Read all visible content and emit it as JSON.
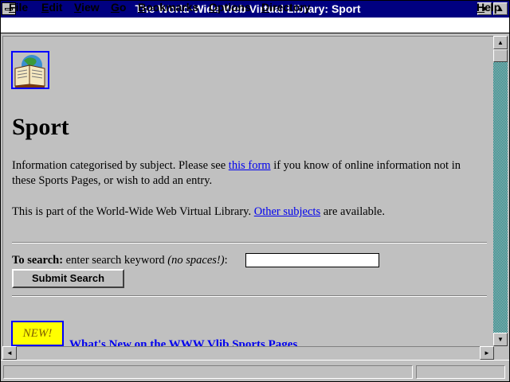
{
  "window": {
    "title": "The World-Wide Web Virtual Library: Sport",
    "minimize_glyph": "▼",
    "maximize_glyph": "▲"
  },
  "menubar": {
    "items": [
      "File",
      "Edit",
      "View",
      "Go",
      "Bookmarks",
      "Options",
      "Directory"
    ],
    "help": "Help"
  },
  "page": {
    "heading": "Sport",
    "intro_before_link": "Information categorised by subject. Please see ",
    "intro_link": "this form",
    "intro_after_link": " if you know of online information not in these Sports Pages, or wish to add an entry.",
    "part_before_link": "This is part of the World-Wide Web Virtual Library. ",
    "part_link": "Other subjects",
    "part_after_link": " are available.",
    "search": {
      "label_bold": "To search:",
      "label_text": " enter search keyword ",
      "label_italic": "(no spaces!)",
      "label_colon": ":",
      "value": "",
      "submit_label": "Submit Search"
    },
    "new_badge": "NEW!",
    "whats_new_link": "What's New on the WWW Vlib Sports Pages"
  },
  "scrollbars": {
    "up_glyph": "▲",
    "down_glyph": "▼",
    "left_glyph": "◄",
    "right_glyph": "►"
  },
  "icons": {
    "logo": "open-book-globe-icon"
  }
}
